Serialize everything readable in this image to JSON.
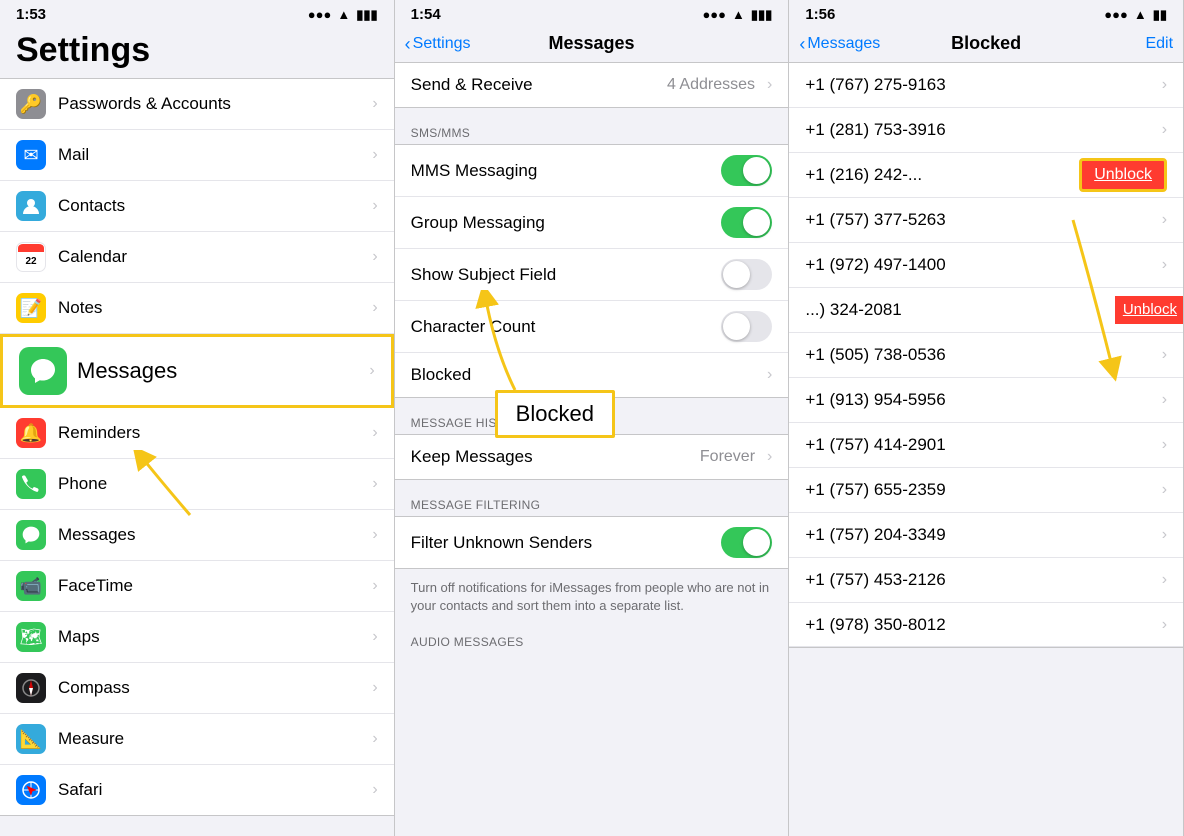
{
  "panel1": {
    "statusBar": {
      "time": "1:53",
      "arrow": "↗",
      "signal": "●●●",
      "wifi": "WiFi",
      "battery": "🔋"
    },
    "title": "Settings",
    "items": [
      {
        "id": "passwords",
        "label": "Passwords & Accounts",
        "iconBg": "#8e8e93",
        "iconEmoji": "🔑"
      },
      {
        "id": "mail",
        "label": "Mail",
        "iconBg": "#007aff",
        "iconEmoji": "✉️"
      },
      {
        "id": "contacts",
        "label": "Contacts",
        "iconBg": "#34aadc",
        "iconEmoji": "👤"
      },
      {
        "id": "calendar",
        "label": "Calendar",
        "iconBg": "#ff3b30",
        "iconEmoji": "📅"
      },
      {
        "id": "notes",
        "label": "Notes",
        "iconBg": "#ffcc00",
        "iconEmoji": "📝"
      },
      {
        "id": "messages",
        "label": "Messages",
        "iconBg": "#34c759",
        "iconEmoji": "💬",
        "highlighted": true
      },
      {
        "id": "reminders",
        "label": "Reminders",
        "iconBg": "#ff3b30",
        "iconEmoji": "🔔"
      },
      {
        "id": "phone",
        "label": "Phone",
        "iconBg": "#34c759",
        "iconEmoji": "📞"
      },
      {
        "id": "facetime",
        "label": "FaceTime",
        "iconBg": "#34c759",
        "iconEmoji": "📹"
      },
      {
        "id": "maps",
        "label": "Maps",
        "iconBg": "#34c759",
        "iconEmoji": "🗺️"
      },
      {
        "id": "compass",
        "label": "Compass",
        "iconBg": "#000",
        "iconEmoji": "🧭"
      },
      {
        "id": "measure",
        "label": "Measure",
        "iconBg": "#34aadc",
        "iconEmoji": "📏"
      },
      {
        "id": "safari",
        "label": "Safari",
        "iconBg": "#007aff",
        "iconEmoji": "🧭"
      }
    ]
  },
  "panel2": {
    "statusBar": {
      "time": "1:54",
      "arrow": "↗"
    },
    "backLabel": "Settings",
    "title": "Messages",
    "sendReceiveLabel": "Send & Receive",
    "sendReceiveValue": "4 Addresses",
    "sections": {
      "smsmms": {
        "header": "SMS/MMS",
        "items": [
          {
            "id": "mms",
            "label": "MMS Messaging",
            "toggleOn": true
          },
          {
            "id": "group",
            "label": "Group Messaging",
            "toggleOn": true
          },
          {
            "id": "subject",
            "label": "Show Subject Field",
            "toggleOn": false
          },
          {
            "id": "charcount",
            "label": "Character Count",
            "toggleOn": false
          },
          {
            "id": "blocked",
            "label": "Blocked",
            "hasChevron": true
          }
        ]
      },
      "messageHistory": {
        "header": "MESSAGE HISTORY",
        "items": [
          {
            "id": "keepmessages",
            "label": "Keep Messages",
            "value": "Forever"
          }
        ]
      },
      "messageFiltering": {
        "header": "MESSAGE FILTERING",
        "items": [
          {
            "id": "filterunknown",
            "label": "Filter Unknown Senders",
            "toggleOn": true
          }
        ]
      }
    },
    "filterDesc": "Turn off notifications for iMessages from people who are not in your contacts and sort them into a separate list.",
    "audioHeader": "AUDIO MESSAGES"
  },
  "panel3": {
    "statusBar": {
      "time": "1:56",
      "arrow": "↗"
    },
    "backLabel": "Messages",
    "title": "Blocked",
    "editLabel": "Edit",
    "contacts": [
      {
        "number": "+1 (767) 275-9163"
      },
      {
        "number": "+1 (281) 753-3916"
      },
      {
        "number": "+1 (216) 242-...",
        "unblockHighlighted": true
      },
      {
        "number": "+1 (757) 377-5263"
      },
      {
        "number": "+1 (972) 497-1400"
      },
      {
        "number": "...) 324-2081",
        "unblockPartial": true
      },
      {
        "number": "+1 (505) 738-0536"
      },
      {
        "number": "+1 (913) 954-5956"
      },
      {
        "number": "+1 (757) 414-2901"
      },
      {
        "number": "+1 (757) 655-2359"
      },
      {
        "number": "+1 (757) 204-3349"
      },
      {
        "number": "+1 (757) 453-2126"
      },
      {
        "number": "+1 (978) 350-8012"
      }
    ],
    "unblockLabel": "Unblock"
  },
  "annotations": {
    "blockedBoxLabel": "Blocked",
    "messagesBoxLabel": "Messages"
  }
}
